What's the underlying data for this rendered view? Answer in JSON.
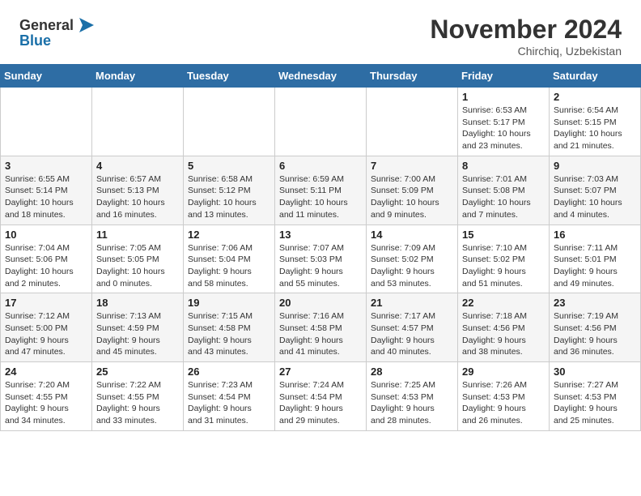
{
  "header": {
    "logo_line1": "General",
    "logo_line2": "Blue",
    "month": "November 2024",
    "location": "Chirchiq, Uzbekistan"
  },
  "weekdays": [
    "Sunday",
    "Monday",
    "Tuesday",
    "Wednesday",
    "Thursday",
    "Friday",
    "Saturday"
  ],
  "weeks": [
    {
      "days": [
        {
          "num": "",
          "info": ""
        },
        {
          "num": "",
          "info": ""
        },
        {
          "num": "",
          "info": ""
        },
        {
          "num": "",
          "info": ""
        },
        {
          "num": "",
          "info": ""
        },
        {
          "num": "1",
          "info": "Sunrise: 6:53 AM\nSunset: 5:17 PM\nDaylight: 10 hours\nand 23 minutes."
        },
        {
          "num": "2",
          "info": "Sunrise: 6:54 AM\nSunset: 5:15 PM\nDaylight: 10 hours\nand 21 minutes."
        }
      ]
    },
    {
      "days": [
        {
          "num": "3",
          "info": "Sunrise: 6:55 AM\nSunset: 5:14 PM\nDaylight: 10 hours\nand 18 minutes."
        },
        {
          "num": "4",
          "info": "Sunrise: 6:57 AM\nSunset: 5:13 PM\nDaylight: 10 hours\nand 16 minutes."
        },
        {
          "num": "5",
          "info": "Sunrise: 6:58 AM\nSunset: 5:12 PM\nDaylight: 10 hours\nand 13 minutes."
        },
        {
          "num": "6",
          "info": "Sunrise: 6:59 AM\nSunset: 5:11 PM\nDaylight: 10 hours\nand 11 minutes."
        },
        {
          "num": "7",
          "info": "Sunrise: 7:00 AM\nSunset: 5:09 PM\nDaylight: 10 hours\nand 9 minutes."
        },
        {
          "num": "8",
          "info": "Sunrise: 7:01 AM\nSunset: 5:08 PM\nDaylight: 10 hours\nand 7 minutes."
        },
        {
          "num": "9",
          "info": "Sunrise: 7:03 AM\nSunset: 5:07 PM\nDaylight: 10 hours\nand 4 minutes."
        }
      ]
    },
    {
      "days": [
        {
          "num": "10",
          "info": "Sunrise: 7:04 AM\nSunset: 5:06 PM\nDaylight: 10 hours\nand 2 minutes."
        },
        {
          "num": "11",
          "info": "Sunrise: 7:05 AM\nSunset: 5:05 PM\nDaylight: 10 hours\nand 0 minutes."
        },
        {
          "num": "12",
          "info": "Sunrise: 7:06 AM\nSunset: 5:04 PM\nDaylight: 9 hours\nand 58 minutes."
        },
        {
          "num": "13",
          "info": "Sunrise: 7:07 AM\nSunset: 5:03 PM\nDaylight: 9 hours\nand 55 minutes."
        },
        {
          "num": "14",
          "info": "Sunrise: 7:09 AM\nSunset: 5:02 PM\nDaylight: 9 hours\nand 53 minutes."
        },
        {
          "num": "15",
          "info": "Sunrise: 7:10 AM\nSunset: 5:02 PM\nDaylight: 9 hours\nand 51 minutes."
        },
        {
          "num": "16",
          "info": "Sunrise: 7:11 AM\nSunset: 5:01 PM\nDaylight: 9 hours\nand 49 minutes."
        }
      ]
    },
    {
      "days": [
        {
          "num": "17",
          "info": "Sunrise: 7:12 AM\nSunset: 5:00 PM\nDaylight: 9 hours\nand 47 minutes."
        },
        {
          "num": "18",
          "info": "Sunrise: 7:13 AM\nSunset: 4:59 PM\nDaylight: 9 hours\nand 45 minutes."
        },
        {
          "num": "19",
          "info": "Sunrise: 7:15 AM\nSunset: 4:58 PM\nDaylight: 9 hours\nand 43 minutes."
        },
        {
          "num": "20",
          "info": "Sunrise: 7:16 AM\nSunset: 4:58 PM\nDaylight: 9 hours\nand 41 minutes."
        },
        {
          "num": "21",
          "info": "Sunrise: 7:17 AM\nSunset: 4:57 PM\nDaylight: 9 hours\nand 40 minutes."
        },
        {
          "num": "22",
          "info": "Sunrise: 7:18 AM\nSunset: 4:56 PM\nDaylight: 9 hours\nand 38 minutes."
        },
        {
          "num": "23",
          "info": "Sunrise: 7:19 AM\nSunset: 4:56 PM\nDaylight: 9 hours\nand 36 minutes."
        }
      ]
    },
    {
      "days": [
        {
          "num": "24",
          "info": "Sunrise: 7:20 AM\nSunset: 4:55 PM\nDaylight: 9 hours\nand 34 minutes."
        },
        {
          "num": "25",
          "info": "Sunrise: 7:22 AM\nSunset: 4:55 PM\nDaylight: 9 hours\nand 33 minutes."
        },
        {
          "num": "26",
          "info": "Sunrise: 7:23 AM\nSunset: 4:54 PM\nDaylight: 9 hours\nand 31 minutes."
        },
        {
          "num": "27",
          "info": "Sunrise: 7:24 AM\nSunset: 4:54 PM\nDaylight: 9 hours\nand 29 minutes."
        },
        {
          "num": "28",
          "info": "Sunrise: 7:25 AM\nSunset: 4:53 PM\nDaylight: 9 hours\nand 28 minutes."
        },
        {
          "num": "29",
          "info": "Sunrise: 7:26 AM\nSunset: 4:53 PM\nDaylight: 9 hours\nand 26 minutes."
        },
        {
          "num": "30",
          "info": "Sunrise: 7:27 AM\nSunset: 4:53 PM\nDaylight: 9 hours\nand 25 minutes."
        }
      ]
    }
  ]
}
